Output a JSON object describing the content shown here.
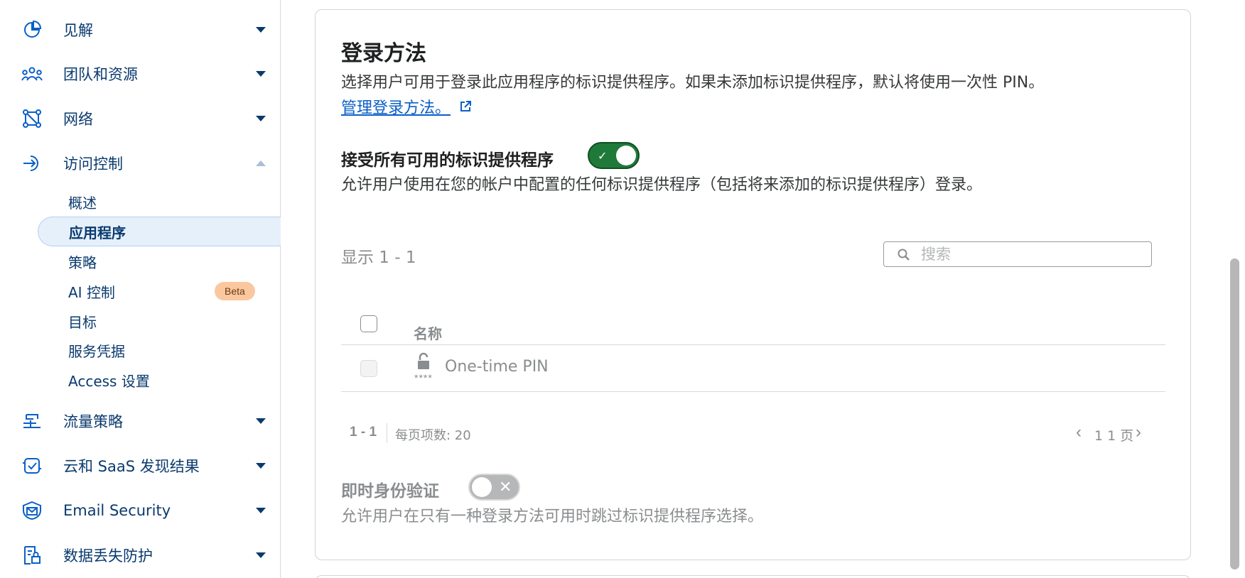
{
  "sidebar": {
    "items": [
      {
        "label": "见解",
        "icon": "pie-chart-icon",
        "expanded": false
      },
      {
        "label": "团队和资源",
        "icon": "people-group-icon",
        "expanded": false
      },
      {
        "label": "网络",
        "icon": "network-graph-icon",
        "expanded": false
      },
      {
        "label": "访问控制",
        "icon": "sign-in-arrow-icon",
        "expanded": true
      },
      {
        "label": "流量策略",
        "icon": "traffic-policy-icon",
        "expanded": false
      },
      {
        "label": "云和 SaaS 发现结果",
        "icon": "cloud-check-icon",
        "expanded": false
      },
      {
        "label": "Email Security",
        "icon": "email-shield-icon",
        "expanded": false
      },
      {
        "label": "数据丢失防护",
        "icon": "document-lock-icon",
        "expanded": false
      }
    ],
    "access_sub_items": [
      {
        "label": "概述"
      },
      {
        "label": "应用程序",
        "active": true
      },
      {
        "label": "策略"
      },
      {
        "label": "AI 控制",
        "badge": "Beta"
      },
      {
        "label": "目标"
      },
      {
        "label": "服务凭据"
      },
      {
        "label": "Access 设置"
      }
    ]
  },
  "main": {
    "title": "登录方法",
    "description": "选择用户可用于登录此应用程序的标识提供程序。如果未添加标识提供程序，默认将使用一次性 PIN。",
    "manage_link": "管理登录方法。",
    "accept_all": {
      "title": "接受所有可用的标识提供程序",
      "enabled": true,
      "description": "允许用户使用在您的帐户中配置的任何标识提供程序（包括将来添加的标识提供程序）登录。"
    },
    "showing": "显示 1 - 1",
    "search": {
      "placeholder": "搜索",
      "value": ""
    },
    "table": {
      "columns": [
        "名称"
      ],
      "rows": [
        {
          "name": "One-time PIN",
          "sub": "****",
          "icon": "unlock-icon",
          "checked": false,
          "disabled": true
        }
      ]
    },
    "pagination": {
      "range": "1 - 1",
      "per_page": "每页项数:  20",
      "page": "1 1 页"
    },
    "instant_auth": {
      "title": "即时身份验证",
      "enabled": false,
      "description": "允许用户在只有一种登录方法可用时跳过标识提供程序选择。"
    }
  },
  "colors": {
    "nav_text": "#0a3a6e",
    "link": "#0a5fc7",
    "toggle_on": "#1f7a3a",
    "toggle_off": "#b5b7b8",
    "active_bg": "#e6f0fb",
    "beta_bg": "#fbc79f"
  }
}
